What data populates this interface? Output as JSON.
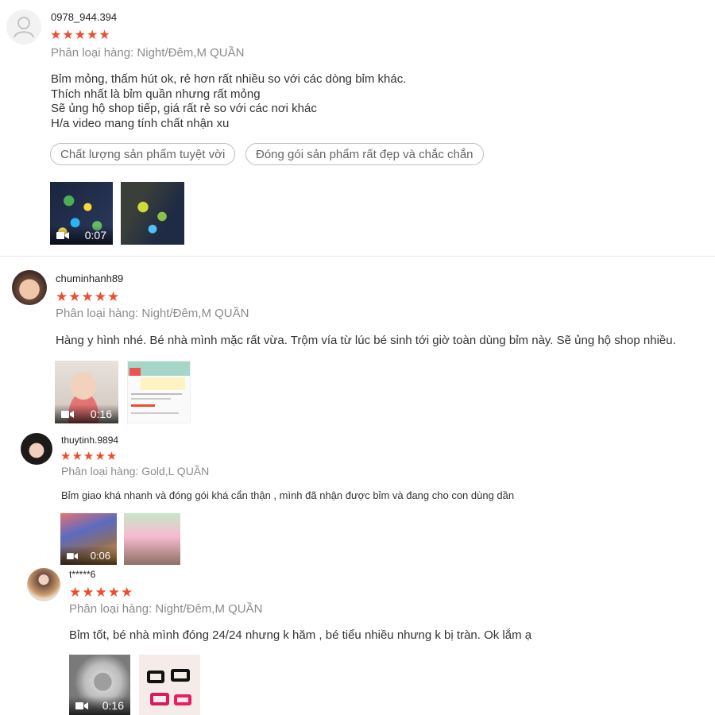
{
  "reviews": [
    {
      "username": "0978_944.394",
      "stars": "★★★★★",
      "variant": "Phân loại hàng: Night/Đêm,M QUẦN",
      "lines": [
        "Bỉm mỏng, thấm hút ok, rẻ hơn rất nhiều so với các dòng bỉm khác.",
        "Thích nhất là bỉm quần nhưng rất mỏng",
        "Sẽ ủng hộ shop tiếp, giá rất rẻ so với các nơi khác",
        "H/a video mang tính chất nhận xu"
      ],
      "tags": [
        "Chất lượng sản phẩm tuyệt vời",
        "Đóng gói sản phẩm rất đẹp và chắc chắn"
      ],
      "video_duration": "0:07"
    },
    {
      "username": "chuminhanh89",
      "stars": "★★★★★",
      "variant": "Phân loại hàng: Night/Đêm,M QUẦN",
      "lines": [
        "Hàng y hình nhé. Bé nhà mình mặc rất vừa. Trộm vía từ lúc bé sinh tới giờ toàn dùng bỉm này. Sẽ ủng hộ shop nhiều."
      ],
      "video_duration": "0:16"
    },
    {
      "username": "thuytinh.9894",
      "stars": "★★★★★",
      "variant": "Phân loại hàng: Gold,L QUẦN",
      "lines": [
        "Bỉm giao khá nhanh và đóng gói khá cẩn thận , mình đã nhận được bỉm và đang cho con dùng dần"
      ],
      "video_duration": "0:06"
    },
    {
      "username": "t*****6",
      "stars": "★★★★★",
      "variant": "Phân loại hàng: Night/Đêm,M QUẦN",
      "lines": [
        "Bỉm tốt, bé nhà mình đóng 24/24 nhưng k hăm , bé tiểu nhiều nhưng k bị tràn. Ok lắm ạ"
      ],
      "video_duration": "0:16"
    }
  ],
  "colors": {
    "star": "#ee4d2d",
    "variant": "#8c8c8c",
    "divider": "#e5e5e5"
  },
  "icons": [
    "user-placeholder-icon",
    "video-camera-icon"
  ]
}
